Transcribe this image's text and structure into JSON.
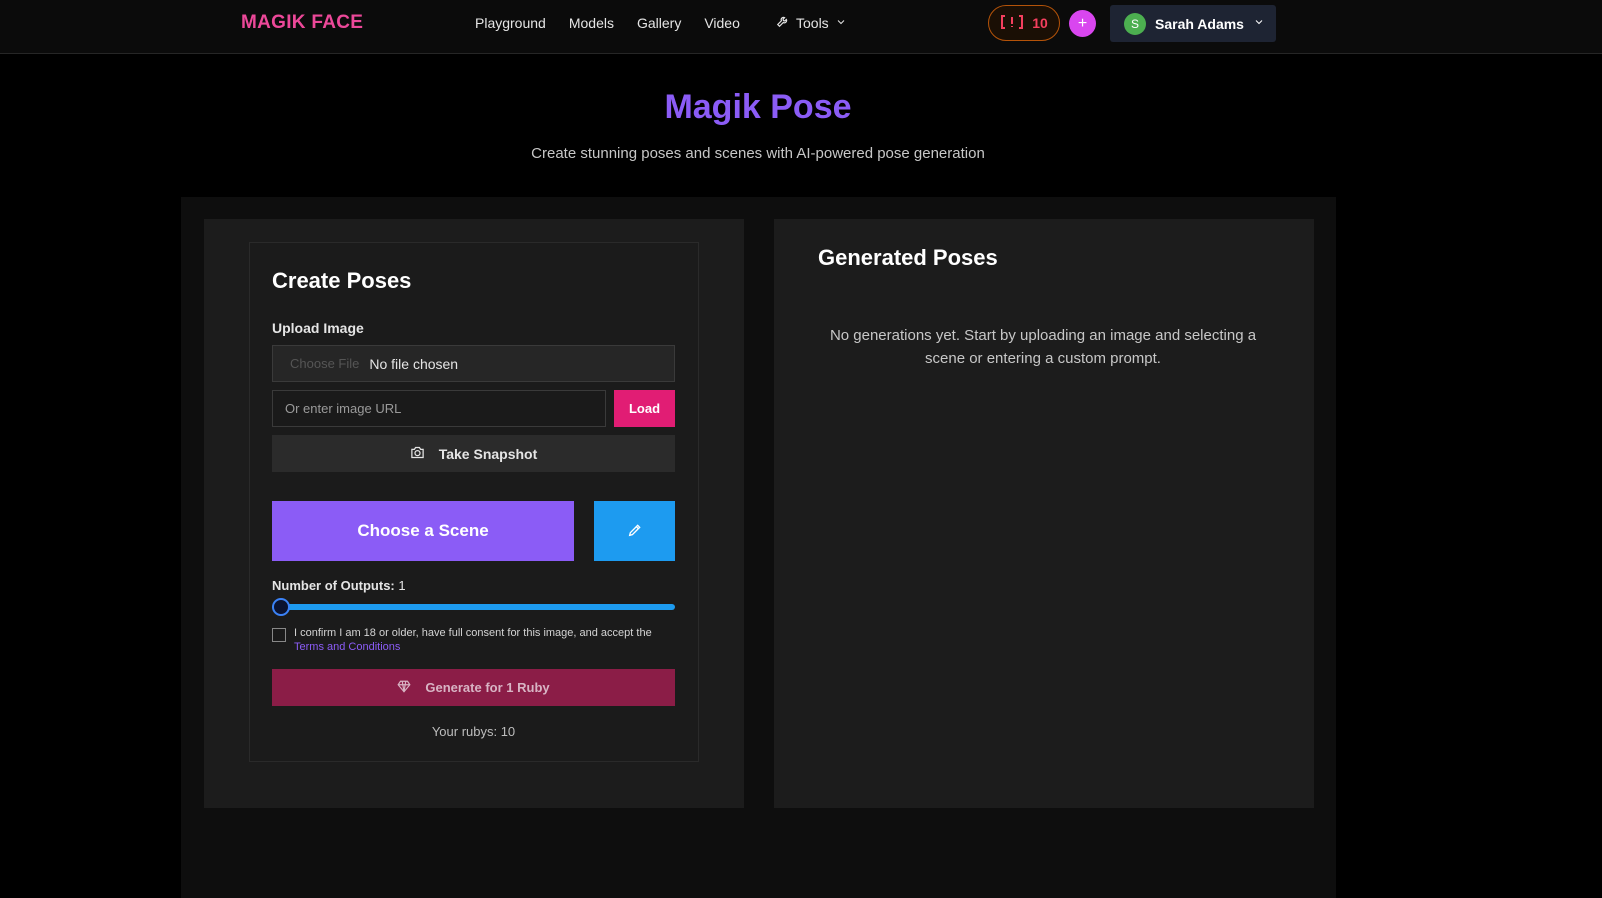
{
  "header": {
    "logo": "MAGIK FACE",
    "nav": [
      "Playground",
      "Models",
      "Gallery",
      "Video"
    ],
    "tools_label": "Tools",
    "ruby_count": "10",
    "plus_label": "+",
    "user": {
      "initial": "S",
      "name": "Sarah Adams"
    }
  },
  "hero": {
    "title": "Magik Pose",
    "subtitle": "Create stunning poses and scenes with AI-powered pose generation"
  },
  "create": {
    "title": "Create Poses",
    "upload_label": "Upload Image",
    "choose_file_label": "Choose File",
    "no_file_text": "No file chosen",
    "url_placeholder": "Or enter image URL",
    "load_label": "Load",
    "snapshot_label": "Take Snapshot",
    "scene_label": "Choose a Scene",
    "outputs_label": "Number of Outputs:",
    "outputs_value": "1",
    "outputs_slider": {
      "min": 1,
      "max": 4,
      "value": 1
    },
    "consent_text": "I confirm I am 18 or older, have full consent for this image, and accept the",
    "terms_link": "Terms and Conditions",
    "generate_label": "Generate for 1 Ruby",
    "rubys_text": "Your rubys: 10"
  },
  "generated": {
    "title": "Generated Poses",
    "empty_message": "No generations yet. Start by uploading an image and selecting a scene or entering a custom prompt."
  },
  "icons": {
    "tools": "wrench-icon",
    "dropdown": "chevron-down-icon",
    "ruby_balance": "ruby-balance-icon",
    "camera": "camera-icon",
    "pen": "pen-icon",
    "gem": "gem-icon"
  },
  "colors": {
    "logo": "#ec4899",
    "title": "#8b5cf6",
    "scene_button": "#8b5cf6",
    "pen_button": "#1d9bf0",
    "load_button": "#e11d74",
    "generate_button": "#8b1d47",
    "ruby_text": "#f43f5e",
    "plus_button": "#d946ef"
  }
}
